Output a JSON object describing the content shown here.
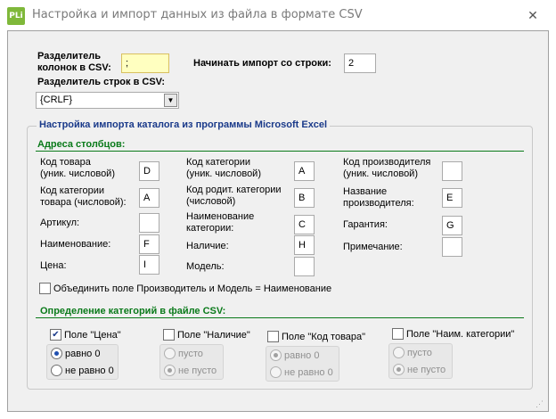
{
  "window": {
    "title": "Настройка и импорт данных из файла в формате CSV",
    "icon_text": "PLi"
  },
  "top": {
    "col_sep_label": "Разделитель\nколонок в CSV:",
    "col_sep_value": ";",
    "start_row_label": "Начинать импорт со строки:",
    "start_row_value": "2",
    "row_sep_label": "Разделитель строк в CSV:",
    "row_sep_value": "{CRLF}"
  },
  "catalog": {
    "title": "Настройка импорта каталога из программы Microsoft Excel",
    "columns_title": "Адреса столбцов:",
    "fields": [
      {
        "label": "Код товара\n(уник. числовой)",
        "value": "D"
      },
      {
        "label": "Код категории\nтовара (числовой):",
        "value": "A"
      },
      {
        "label": "Артикул:",
        "value": ""
      },
      {
        "label": "Наименование:",
        "value": "F"
      },
      {
        "label": "Цена:",
        "value": "I"
      },
      {
        "label": "Код категории\n(уник. числовой)",
        "value": "A"
      },
      {
        "label": "Код родит. категории\n(числовой)",
        "value": "B"
      },
      {
        "label": "Наименование\nкатегории:",
        "value": "C"
      },
      {
        "label": "Наличие:",
        "value": "H"
      },
      {
        "label": "Модель:",
        "value": ""
      },
      {
        "label": "Код производителя\n(уник. числовой)",
        "value": ""
      },
      {
        "label": "Название\nпроизводителя:",
        "value": "E"
      },
      {
        "label": "Гарантия:",
        "value": "G"
      },
      {
        "label": "Примечание:",
        "value": ""
      }
    ],
    "merge_label": "Объединить поле Производитель и Модель = Наименование",
    "categories_title": "Определение категорий в файле CSV:",
    "groups": [
      {
        "label": "Поле \"Цена\"",
        "checked": true,
        "opt1": "равно 0",
        "opt2": "не равно 0",
        "selected": 1
      },
      {
        "label": "Поле \"Наличие\"",
        "checked": false,
        "opt1": "пусто",
        "opt2": "не пусто",
        "selected": 2
      },
      {
        "label": "Поле \"Код товара\"",
        "checked": false,
        "opt1": "равно 0",
        "opt2": "не равно 0",
        "selected": 1
      },
      {
        "label": "Поле \"Наим. категории\"",
        "checked": false,
        "opt1": "пусто",
        "opt2": "не пусто",
        "selected": 2
      }
    ]
  },
  "icons": {
    "close": "close-icon",
    "dropdown": "chevron-down-icon",
    "check": "check-icon"
  },
  "colors": {
    "group_title": "#1a3a8a",
    "section_title": "#0a7a1a",
    "highlight_input": "#ffffc0"
  }
}
